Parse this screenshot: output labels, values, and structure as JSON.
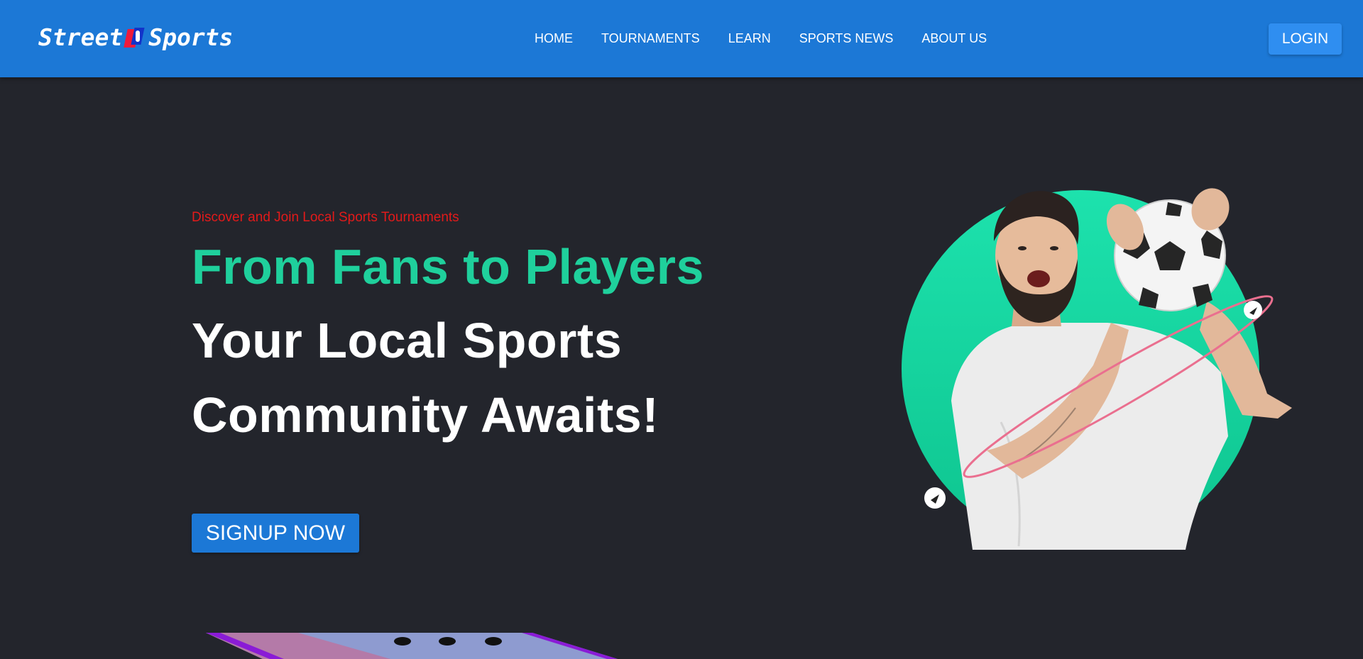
{
  "brand": {
    "logo_left": "Street",
    "logo_right": "Sports",
    "colors": {
      "nav_bg": "#1c78d6",
      "accent_green": "#1fd09c",
      "tagline_red": "#e31a1a",
      "page_bg": "#23252c"
    }
  },
  "nav": {
    "items": [
      {
        "label": "HOME"
      },
      {
        "label": "TOURNAMENTS"
      },
      {
        "label": "LEARN"
      },
      {
        "label": "SPORTS NEWS"
      },
      {
        "label": "ABOUT US"
      }
    ],
    "login_label": "LOGIN"
  },
  "hero": {
    "tagline": "Discover and Join Local Sports Tournaments",
    "headline_1": "From Fans to Players",
    "headline_2": "Your Local Sports",
    "headline_3": "Community Awaits!",
    "signup_label": "SIGNUP NOW"
  }
}
